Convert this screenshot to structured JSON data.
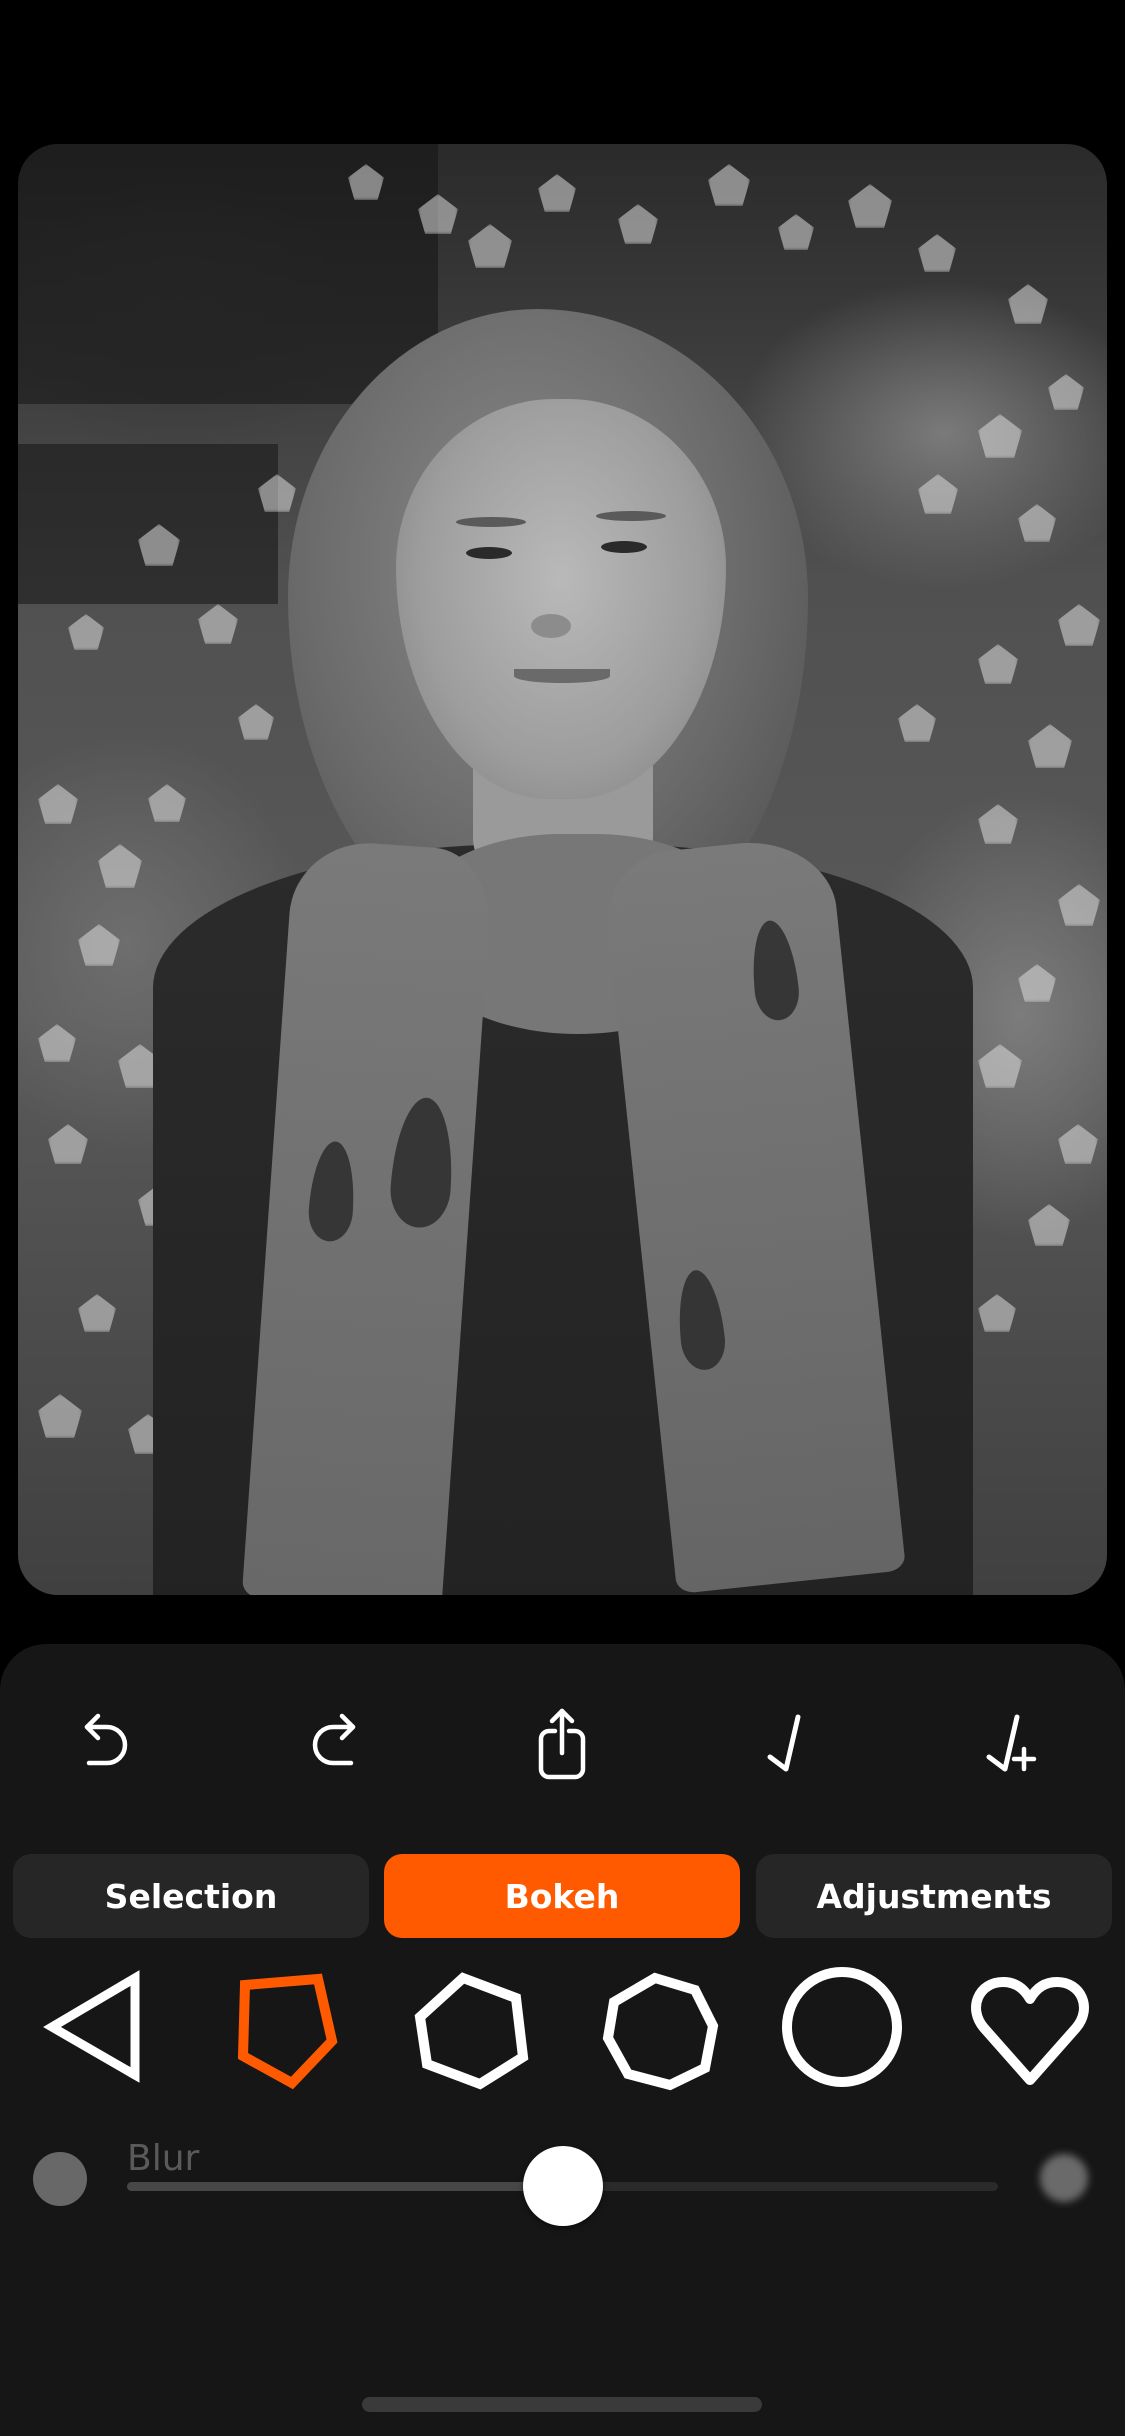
{
  "photo": {
    "description": "Grayscale portrait of a woman with wavy shoulder-length hair wearing a patterned scarf, pentagon-shaped bokeh lights in background",
    "alt": "Portrait photo with bokeh background"
  },
  "toolbar": {
    "items": [
      {
        "id": "undo",
        "icon": "undo-arrow-icon",
        "label": "Undo"
      },
      {
        "id": "redo",
        "icon": "redo-arrow-icon",
        "label": "Redo"
      },
      {
        "id": "share",
        "icon": "share-icon",
        "label": "Share"
      },
      {
        "id": "apply",
        "icon": "checkmark-icon",
        "label": "Apply"
      },
      {
        "id": "apply-add",
        "icon": "checkmark-plus-icon",
        "label": "Apply and add"
      }
    ]
  },
  "tabs": {
    "items": [
      {
        "label": "Selection",
        "active": false
      },
      {
        "label": "Bokeh",
        "active": true
      },
      {
        "label": "Adjustments",
        "active": false
      }
    ]
  },
  "bokeh_shapes": {
    "selected": "pentagon",
    "items": [
      {
        "id": "triangle",
        "icon": "triangle-icon"
      },
      {
        "id": "pentagon",
        "icon": "pentagon-icon"
      },
      {
        "id": "hexagon",
        "icon": "hexagon-icon"
      },
      {
        "id": "heptagon",
        "icon": "heptagon-icon"
      },
      {
        "id": "circle",
        "icon": "circle-icon"
      },
      {
        "id": "heart",
        "icon": "heart-icon"
      }
    ]
  },
  "slider": {
    "label": "Blur",
    "value": 0.5,
    "min_icon": "sharp-dot-icon",
    "max_icon": "blurred-dot-icon"
  },
  "colors": {
    "accent": "#FF5A00",
    "panel_bg": "#161616",
    "tab_bg": "#262626",
    "icon": "#FFFFFF"
  }
}
